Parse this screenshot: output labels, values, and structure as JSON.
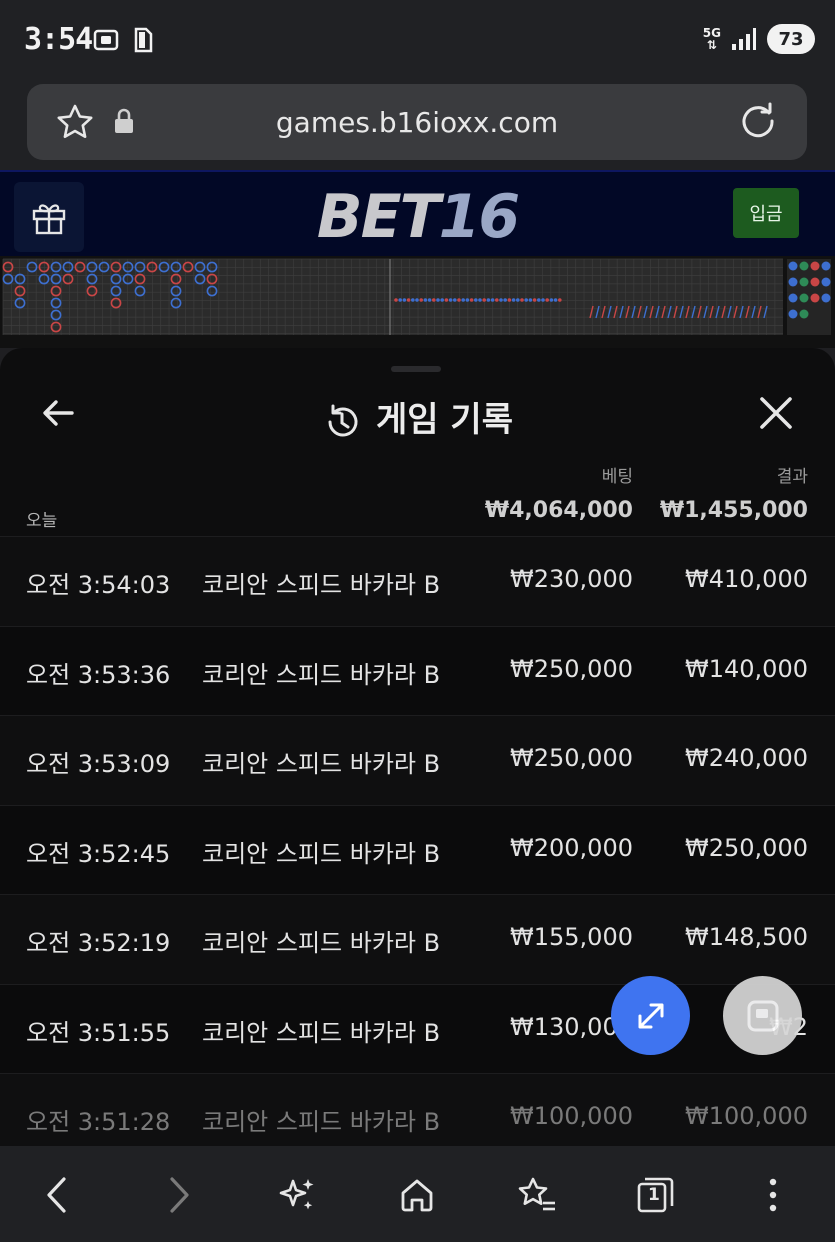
{
  "status_bar": {
    "time": "3:54",
    "network": "5G",
    "battery": "73"
  },
  "browser": {
    "url": "games.b16ioxx.com"
  },
  "site": {
    "logo_part1": "BET",
    "logo_part2": "16",
    "deposit_label": "입금"
  },
  "panel": {
    "title": "게임 기록",
    "col_bet": "베팅",
    "col_result": "결과",
    "today_label": "오늘",
    "total_bet": "₩4,064,000",
    "total_result": "₩1,455,000",
    "rows": [
      {
        "time": "오전 3:54:03",
        "game": "코리안 스피드 바카라 B",
        "bet": "₩230,000",
        "result": "₩410,000"
      },
      {
        "time": "오전 3:53:36",
        "game": "코리안 스피드 바카라 B",
        "bet": "₩250,000",
        "result": "₩140,000"
      },
      {
        "time": "오전 3:53:09",
        "game": "코리안 스피드 바카라 B",
        "bet": "₩250,000",
        "result": "₩240,000"
      },
      {
        "time": "오전 3:52:45",
        "game": "코리안 스피드 바카라 B",
        "bet": "₩200,000",
        "result": "₩250,000"
      },
      {
        "time": "오전 3:52:19",
        "game": "코리안 스피드 바카라 B",
        "bet": "₩155,000",
        "result": "₩148,500"
      },
      {
        "time": "오전 3:51:55",
        "game": "코리안 스피드 바카라 B",
        "bet": "₩130,000",
        "result": "₩2"
      },
      {
        "time": "오전 3:51:28",
        "game": "코리안 스피드 바카라 B",
        "bet": "₩100,000",
        "result": "₩100,000"
      }
    ]
  },
  "bottom_nav": {
    "tabs_count": "1"
  },
  "colors": {
    "accent_blue": "#3f74f0",
    "deposit_green": "#1d5b1f",
    "header_navy": "#020826"
  }
}
